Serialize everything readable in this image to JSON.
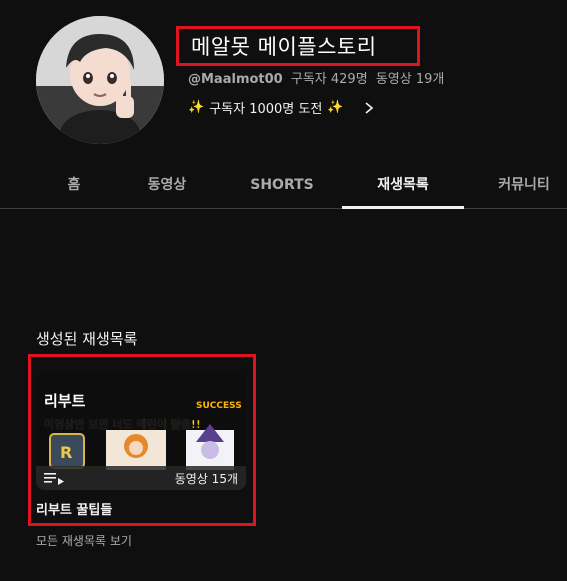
{
  "channel": {
    "title": "메알못 메이플스토리",
    "handle": "@Maalmot00",
    "subscribers": "구독자 429명",
    "videos": "동영상 19개",
    "challenge": {
      "sparkle_left": "✨",
      "text": "구독자 1000명 도전",
      "sparkle_right": "✨"
    }
  },
  "tabs": [
    {
      "label": "홈",
      "active": false
    },
    {
      "label": "동영상",
      "active": false
    },
    {
      "label": "SHORTS",
      "active": false
    },
    {
      "label": "재생목록",
      "active": true
    },
    {
      "label": "커뮤니티",
      "active": false
    }
  ],
  "section": {
    "title": "생성된 재생목록",
    "playlists": [
      {
        "title": "리부트 꿀팁들",
        "video_count": "동영상 15개",
        "thumbnail": {
          "tag": "리부트",
          "headline": "이영상만 보면 너도 메린이 탈출!!",
          "badge": "SUCCESS"
        }
      }
    ],
    "view_all": "모든 재생목록 보기"
  },
  "colors": {
    "background": "#0f0f0f",
    "highlight_border": "#e0141e",
    "secondary_text": "#aaaaaa"
  }
}
